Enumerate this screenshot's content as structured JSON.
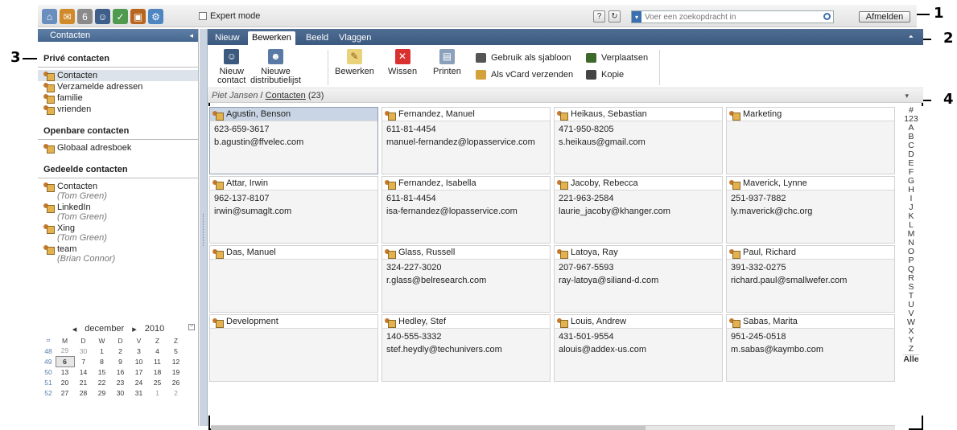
{
  "topbar": {
    "apps": [
      {
        "icon": "home-icon",
        "color": "#6a8fbf",
        "glyph": "⌂"
      },
      {
        "icon": "mail-icon",
        "color": "#d08a2a",
        "glyph": "✉"
      },
      {
        "icon": "calendar-icon",
        "color": "#8a8a8a",
        "glyph": "6"
      },
      {
        "icon": "contacts-icon",
        "color": "#3d5f8a",
        "glyph": "☺"
      },
      {
        "icon": "tasks-icon",
        "color": "#4f9a4f",
        "glyph": "✓"
      },
      {
        "icon": "infostore-icon",
        "color": "#b8651f",
        "glyph": "▣"
      },
      {
        "icon": "settings-gear-icon",
        "color": "#4e86c2",
        "glyph": "⚙"
      }
    ],
    "expert_mode_label": "Expert mode",
    "search_placeholder": "Voer een zoekopdracht in",
    "logout_label": "Afmelden",
    "help_glyph": "?",
    "refresh_glyph": "↻"
  },
  "callouts": [
    "1",
    "2",
    "3",
    "4"
  ],
  "sidebar": {
    "title": "Contacten",
    "private_title": "Privé contacten",
    "private_items": [
      {
        "label": "Contacten",
        "selected": true
      },
      {
        "label": "Verzamelde adressen"
      },
      {
        "label": "familie"
      },
      {
        "label": "vrienden"
      }
    ],
    "public_title": "Openbare contacten",
    "public_items": [
      {
        "label": "Globaal adresboek"
      }
    ],
    "shared_title": "Gedeelde contacten",
    "shared_items": [
      {
        "label": "Contacten",
        "owner": "(Tom Green)"
      },
      {
        "label": "LinkedIn",
        "owner": "(Tom Green)"
      },
      {
        "label": "Xing",
        "owner": "(Tom Green)"
      },
      {
        "label": "team",
        "owner": "(Brian Connor)"
      }
    ]
  },
  "calendar": {
    "prev": "◂",
    "next": "▸",
    "month": "december",
    "year": "2010",
    "weekday_headers": [
      "M",
      "D",
      "W",
      "D",
      "V",
      "Z",
      "Z"
    ],
    "weeks": [
      {
        "wk": "48",
        "days": [
          "29",
          "30",
          "1",
          "2",
          "3",
          "4",
          "5"
        ],
        "dim": [
          0,
          1
        ]
      },
      {
        "wk": "49",
        "days": [
          "6",
          "7",
          "8",
          "9",
          "10",
          "11",
          "12"
        ],
        "today": 0
      },
      {
        "wk": "50",
        "days": [
          "13",
          "14",
          "15",
          "16",
          "17",
          "18",
          "19"
        ]
      },
      {
        "wk": "51",
        "days": [
          "20",
          "21",
          "22",
          "23",
          "24",
          "25",
          "26"
        ]
      },
      {
        "wk": "52",
        "days": [
          "27",
          "28",
          "29",
          "30",
          "31",
          "1",
          "2"
        ],
        "dim": [
          5,
          6
        ]
      }
    ]
  },
  "tabs": [
    {
      "label": "Nieuw",
      "active": false
    },
    {
      "label": "Bewerken",
      "active": true
    },
    {
      "label": "Beeld",
      "active": false
    },
    {
      "label": "Vlaggen",
      "active": false
    }
  ],
  "toolbar": {
    "new_contact": "Nieuw\ncontact",
    "new_distlist": "Nieuwe\ndistributielijst",
    "edit": "Bewerken",
    "delete": "Wissen",
    "print": "Printen",
    "use_template": "Gebruik als sjabloon",
    "send_vcard": "Als vCard verzenden",
    "move": "Verplaatsen",
    "copy": "Kopie"
  },
  "pathbar": {
    "user": "Piet Jansen",
    "sep": " / ",
    "folder": "Contacten",
    "count": " (23)"
  },
  "contacts": [
    {
      "name": "Agustin, Benson",
      "phone": "623-659-3617",
      "email": "b.agustin@ffvelec.com",
      "selected": true
    },
    {
      "name": "Fernandez, Manuel",
      "phone": "611-81-4454",
      "email": "manuel-fernandez@lopasservice.com"
    },
    {
      "name": "Heikaus, Sebastian",
      "phone": "471-950-8205",
      "email": "s.heikaus@gmail.com"
    },
    {
      "name": "Marketing",
      "phone": "",
      "email": ""
    },
    {
      "name": "Attar, Irwin",
      "phone": "962-137-8107",
      "email": "irwin@sumaglt.com"
    },
    {
      "name": "Fernandez, Isabella",
      "phone": "611-81-4454",
      "email": "isa-fernandez@lopasservice.com"
    },
    {
      "name": "Jacoby, Rebecca",
      "phone": "221-963-2584",
      "email": "laurie_jacoby@khanger.com"
    },
    {
      "name": "Maverick, Lynne",
      "phone": "251-937-7882",
      "email": "ly.maverick@chc.org"
    },
    {
      "name": "Das, Manuel",
      "phone": "",
      "email": ""
    },
    {
      "name": "Glass, Russell",
      "phone": "324-227-3020",
      "email": "r.glass@belresearch.com"
    },
    {
      "name": "Latoya, Ray",
      "phone": "207-967-5593",
      "email": "ray-latoya@siliand-d.com"
    },
    {
      "name": "Paul, Richard",
      "phone": "391-332-0275",
      "email": "richard.paul@smallwefer.com"
    },
    {
      "name": "Development",
      "phone": "",
      "email": ""
    },
    {
      "name": "Hedley, Stef",
      "phone": "140-555-3332",
      "email": "stef.heydly@techunivers.com"
    },
    {
      "name": "Louis, Andrew",
      "phone": "431-501-9554",
      "email": "alouis@addex-us.com"
    },
    {
      "name": "Sabas, Marita",
      "phone": "951-245-0518",
      "email": "m.sabas@kaymbo.com"
    }
  ],
  "alphabet": [
    "#",
    "123",
    "A",
    "B",
    "C",
    "D",
    "E",
    "F",
    "G",
    "H",
    "I",
    "J",
    "K",
    "L",
    "M",
    "N",
    "O",
    "P",
    "Q",
    "R",
    "S",
    "T",
    "U",
    "V",
    "W",
    "X",
    "Y",
    "Z"
  ],
  "alphabet_all": "Alle"
}
